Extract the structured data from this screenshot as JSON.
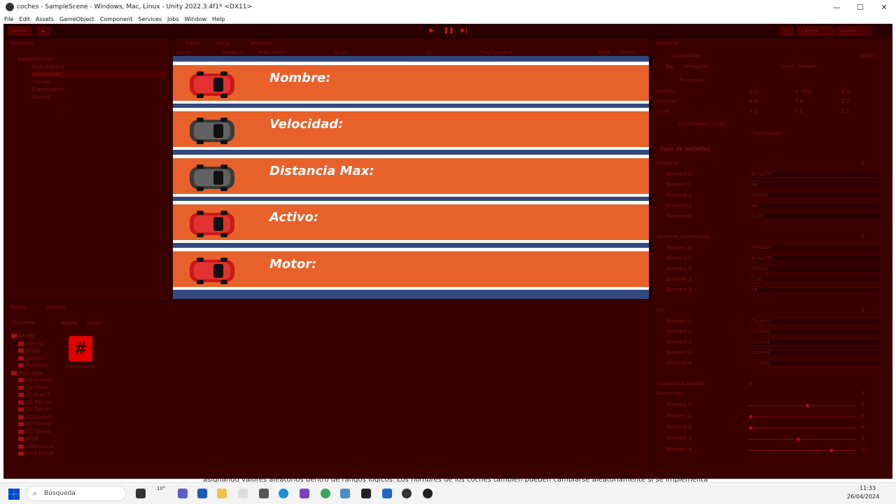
{
  "window": {
    "title": "coches - SampleScene - Windows, Mac, Linux - Unity 2022.3.4f1* <DX11>",
    "minimize": "—",
    "maximize": "☐",
    "close": "✕"
  },
  "menu": [
    "File",
    "Edit",
    "Assets",
    "GameObject",
    "Component",
    "Services",
    "Jobs",
    "Window",
    "Help"
  ],
  "toolbar": {
    "account": "Sesión",
    "cloud": "☁",
    "play": "▶",
    "pause": "❚❚",
    "step": "▶|",
    "collab": "Layout",
    "layers": "Layers",
    "search": "⌕"
  },
  "hierarchy": {
    "tab": "Hierarchy",
    "items": [
      "SampleScene*",
      "Main Camera",
      "Controlador",
      "Canvas",
      "EventSystem",
      "Coches"
    ]
  },
  "center_tabs": [
    "Scene",
    "Game",
    "Animator"
  ],
  "game_toolbar": {
    "display": "Game",
    "display_num": "Display 1",
    "aspect": "Free Aspect",
    "scale_label": "Scale",
    "scale_val": "1x",
    "play_focused": "Play Focused",
    "stats": "Stats",
    "gizmos": "Gizmos"
  },
  "game": {
    "lanes": [
      {
        "label": "Nombre:",
        "car": "red"
      },
      {
        "label": "Velocidad:",
        "car": "grey"
      },
      {
        "label": "Distancia Max:",
        "car": "grey"
      },
      {
        "label": "Activo:",
        "car": "red"
      },
      {
        "label": "Motor:",
        "car": "red"
      }
    ]
  },
  "inspector": {
    "tab": "Inspector",
    "object_name": "Controlador",
    "static_label": "Static",
    "tag_label": "Tag",
    "tag_value": "Untagged",
    "layer_label": "Layer",
    "layer_value": "Default",
    "transform": "Transform",
    "position_label": "Position",
    "pos": [
      "X 0",
      "Y -373",
      "Z 0"
    ],
    "rotation_label": "Rotation",
    "rot": [
      "X 0",
      "Y 0",
      "Z 0"
    ],
    "scale_label": "Scale",
    "scl": [
      "X 1",
      "Y 1",
      "Z 1"
    ],
    "script_component": "Controlador (Script)",
    "script_label": "Controlador",
    "tipos_label": "Tipos de Variables",
    "nombres_label": "Nombres",
    "nombres_count": "5",
    "nombres": [
      [
        "Element 0",
        "BUGATTI"
      ],
      [
        "Element 1",
        "A4"
      ],
      [
        "Element 2",
        "SERRIS"
      ],
      [
        "Element 3",
        "A4"
      ],
      [
        "Element 4",
        "CLIO"
      ]
    ],
    "alt_label": "Nombres Alternativos",
    "alt_count": "5",
    "alt": [
      [
        "Element 0",
        "FERRARI"
      ],
      [
        "Element 1",
        "BUGATTI"
      ],
      [
        "Element 2",
        "SERRIS"
      ],
      [
        "Element 3",
        "CLIO"
      ],
      [
        "Element 4",
        "A4"
      ]
    ],
    "go_label": "GO",
    "go_count": "5",
    "go": [
      [
        "Element 0",
        "Coche1"
      ],
      [
        "Element 1",
        "Coche2"
      ],
      [
        "Element 2",
        "Coche3"
      ],
      [
        "Element 3",
        "Coche4"
      ],
      [
        "Element 4",
        "Coche5"
      ]
    ],
    "contador_label": "Contador Activados",
    "contador_val": "0",
    "dist_label": "Distancias",
    "dist_count": "5",
    "dist": [
      [
        "Element 0",
        "5",
        0.55
      ],
      [
        "Element 1",
        "0",
        0.0
      ],
      [
        "Element 2",
        "0",
        0.0
      ],
      [
        "Element 3",
        "3",
        0.46
      ],
      [
        "Element 4",
        "12",
        0.78
      ]
    ]
  },
  "project": {
    "tabs": [
      "Project",
      "Console"
    ],
    "favorites": "Favorites",
    "breadcrumb": [
      "Assets",
      "Script"
    ],
    "tree": [
      "Assets",
      "Scenes",
      "Script",
      "Sprites",
      "TextMesh",
      "Packages",
      "2D Animati",
      "2D Comm",
      "2D Pixel P",
      "2D PSD Im",
      "2D Sprite",
      "2D SpriteS",
      "2D Tilema",
      "2D Tilema",
      "Burst",
      "Collections",
      "Core RP Lib"
    ],
    "file_name": "Controlador"
  },
  "caption": "asignando valores aleatorios dentro de rangos lógicos. Los nombres de los coches también pueden cambiarse aleatoriamente si se implementa",
  "taskbar": {
    "search": "Búsqueda",
    "time": "11:33",
    "date": "26/04/2024",
    "temp": "10°"
  }
}
